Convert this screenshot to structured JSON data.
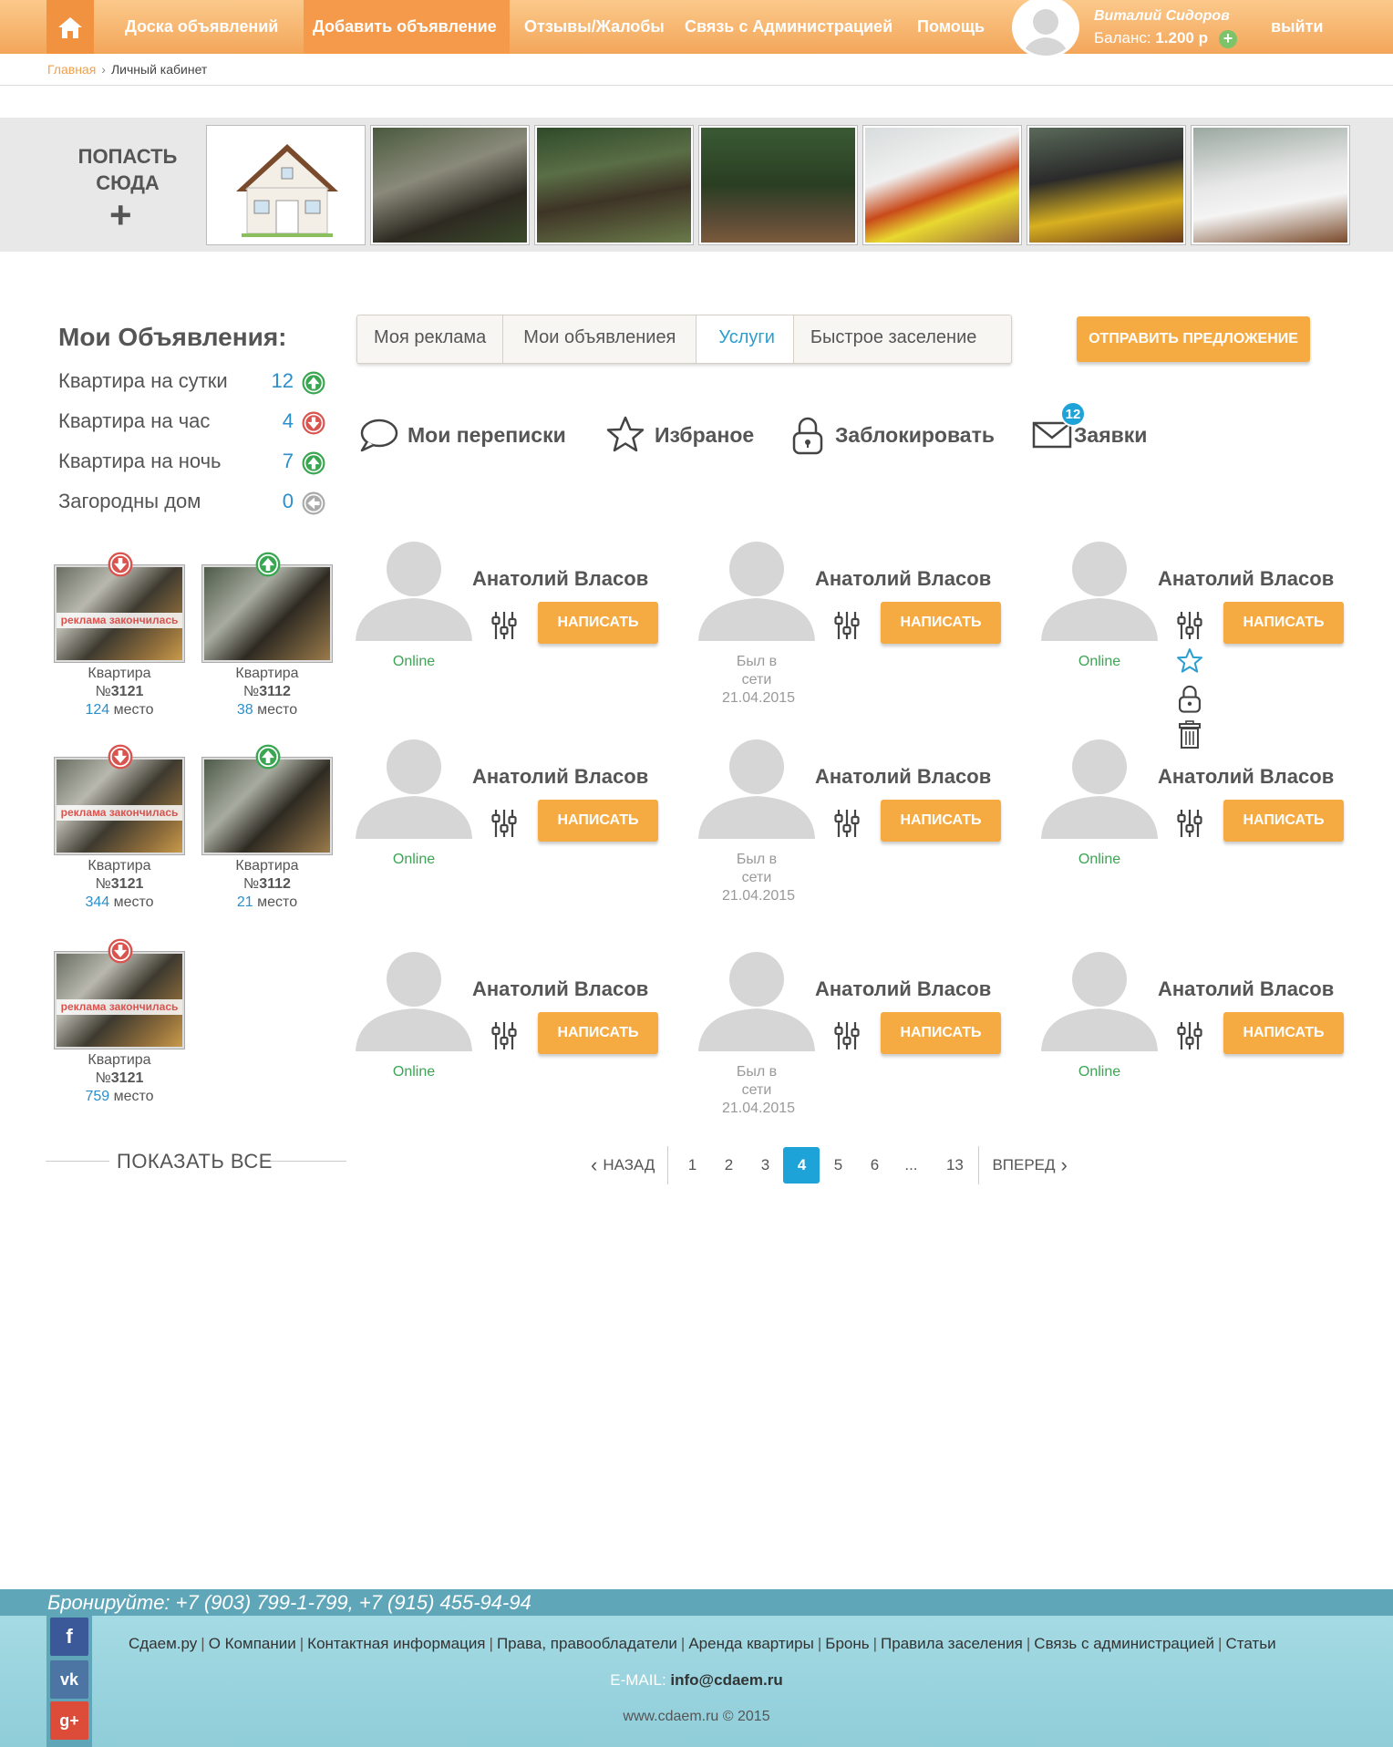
{
  "nav": {
    "items": [
      "Доска объявлений",
      "Добавить объявление",
      "Отзывы/Жалобы",
      "Связь с Администрацией",
      "Помощь"
    ],
    "logout": "выйти"
  },
  "user": {
    "name": "Виталий Сидоров",
    "balance_label": "Баланс:",
    "balance_value": "1.200 р"
  },
  "breadcrumb": {
    "home": "Главная",
    "current": "Личный кабинет"
  },
  "gallery": {
    "get_here": "ПОПАСТЬ СЮДА",
    "plus": "+"
  },
  "my_ads": {
    "title": "Мои Объявления:",
    "rows": [
      {
        "label": "Квартира на сутки",
        "count": "12",
        "trend": "up"
      },
      {
        "label": "Квартира на час",
        "count": "4",
        "trend": "down"
      },
      {
        "label": "Квартира на ночь",
        "count": "7",
        "trend": "up"
      },
      {
        "label": "Загородны дом",
        "count": "0",
        "trend": "neutral"
      }
    ]
  },
  "listings": [
    {
      "title": "Квартира",
      "num_prefix": "№",
      "num": "3121",
      "place": "124",
      "place_label": "место",
      "trend": "down",
      "expired": "реклама закончилась"
    },
    {
      "title": "Квартира",
      "num_prefix": "№",
      "num": "3112",
      "place": "38",
      "place_label": "место",
      "trend": "up",
      "expired": ""
    },
    {
      "title": "Квартира",
      "num_prefix": "№",
      "num": "3121",
      "place": "344",
      "place_label": "место",
      "trend": "down",
      "expired": "реклама закончилась"
    },
    {
      "title": "Квартира",
      "num_prefix": "№",
      "num": "3112",
      "place": "21",
      "place_label": "место",
      "trend": "up",
      "expired": ""
    },
    {
      "title": "Квартира",
      "num_prefix": "№",
      "num": "3121",
      "place": "759",
      "place_label": "место",
      "trend": "down",
      "expired": "реклама закончилась"
    }
  ],
  "show_all": "ПОКАЗАТЬ ВСЕ",
  "tabs": [
    "Моя реклама",
    "Мои объявлениея",
    "Услуги",
    "Быстрое заселение"
  ],
  "send_offer": "ОТПРАВИТЬ ПРЕДЛОЖЕНИЕ",
  "actions": {
    "messages": "Мои переписки",
    "favorites": "Избраное",
    "block": "Заблокировать",
    "requests": "Заявки",
    "requests_badge": "12"
  },
  "cards": [
    {
      "name": "Анатолий Власов",
      "button": "НАПИСАТЬ",
      "status": "Online",
      "online": true
    },
    {
      "name": "Анатолий Власов",
      "button": "НАПИСАТЬ",
      "status": "Был в сети 21.04.2015",
      "online": false
    },
    {
      "name": "Анатолий Власов",
      "button": "НАПИСАТЬ",
      "status": "Online",
      "online": true
    },
    {
      "name": "Анатолий Власов",
      "button": "НАПИСАТЬ",
      "status": "Online",
      "online": true
    },
    {
      "name": "Анатолий Власов",
      "button": "НАПИСАТЬ",
      "status": "Был в сети 21.04.2015",
      "online": false
    },
    {
      "name": "Анатолий Власов",
      "button": "НАПИСАТЬ",
      "status": "Online",
      "online": true
    },
    {
      "name": "Анатолий Власов",
      "button": "НАПИСАТЬ",
      "status": "Online",
      "online": true
    },
    {
      "name": "Анатолий Власов",
      "button": "НАПИСАТЬ",
      "status": "Был в сети 21.04.2015",
      "online": false
    },
    {
      "name": "Анатолий Власов",
      "button": "НАПИСАТЬ",
      "status": "Online",
      "online": true
    }
  ],
  "pagination": {
    "prev": "НАЗАД",
    "next": "ВПЕРЕД",
    "pages": [
      "1",
      "2",
      "3",
      "4",
      "5",
      "6",
      "...",
      "13"
    ],
    "current": "4"
  },
  "footer": {
    "book": "Бронируйте: +7 (903) 799-1-799, +7 (915) 455-94-94",
    "links": [
      "Сдаем.ру",
      "О Компании",
      "Контактная информация",
      "Права, правообладатели",
      "Аренда квартиры",
      "Бронь",
      "Правила заселения",
      "Связь с администрацией",
      "Статьи"
    ],
    "email_label": "E-MAIL:",
    "email": "info@cdaem.ru",
    "copyright": "www.cdaem.ru © 2015"
  },
  "colors": {
    "accent": "#f5ab42",
    "blue": "#1ea3d9",
    "online": "#3aa652",
    "down": "#d9534f"
  }
}
